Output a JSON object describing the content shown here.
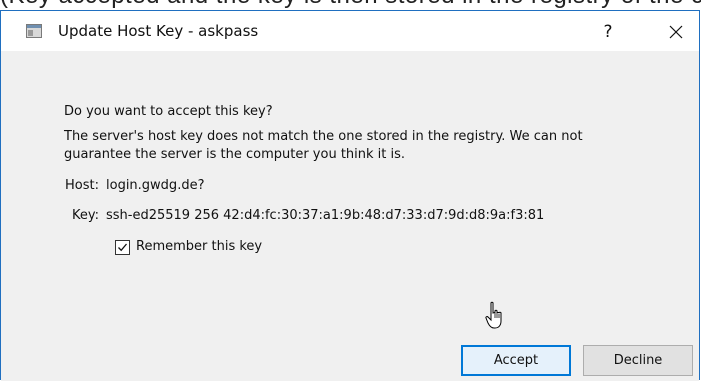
{
  "background_window": {
    "clipped_text": "(Key accepted and the key is then stored in the registry of the computer)"
  },
  "dialog": {
    "title": "Update Host Key - askpass",
    "help_label": "?",
    "question": "Do you want to accept this key?",
    "message_line1": "The server's host key does not match the one stored in the registry. We can not",
    "message_line2": "guarantee the server is the computer you think it is.",
    "host": {
      "label": "Host:",
      "value": "login.gwdg.de?"
    },
    "key": {
      "label": "Key:",
      "value": "ssh-ed25519 256 42:d4:fc:30:37:a1:9b:48:d7:33:d7:9d:d8:9a:f3:81"
    },
    "remember_checkbox": {
      "label": "Remember this key",
      "checked": true
    },
    "buttons": {
      "accept": "Accept",
      "decline": "Decline"
    }
  },
  "colors": {
    "window_border": "#1f6fc0",
    "content_background": "#f0f0f0",
    "default_button_border": "#0078d7",
    "default_button_fill": "#e5f1fb",
    "button_fill": "#e1e1e1"
  },
  "icons": [
    "app-window-icon",
    "close-icon",
    "checkmark-icon",
    "mouse-cursor-icon"
  ]
}
